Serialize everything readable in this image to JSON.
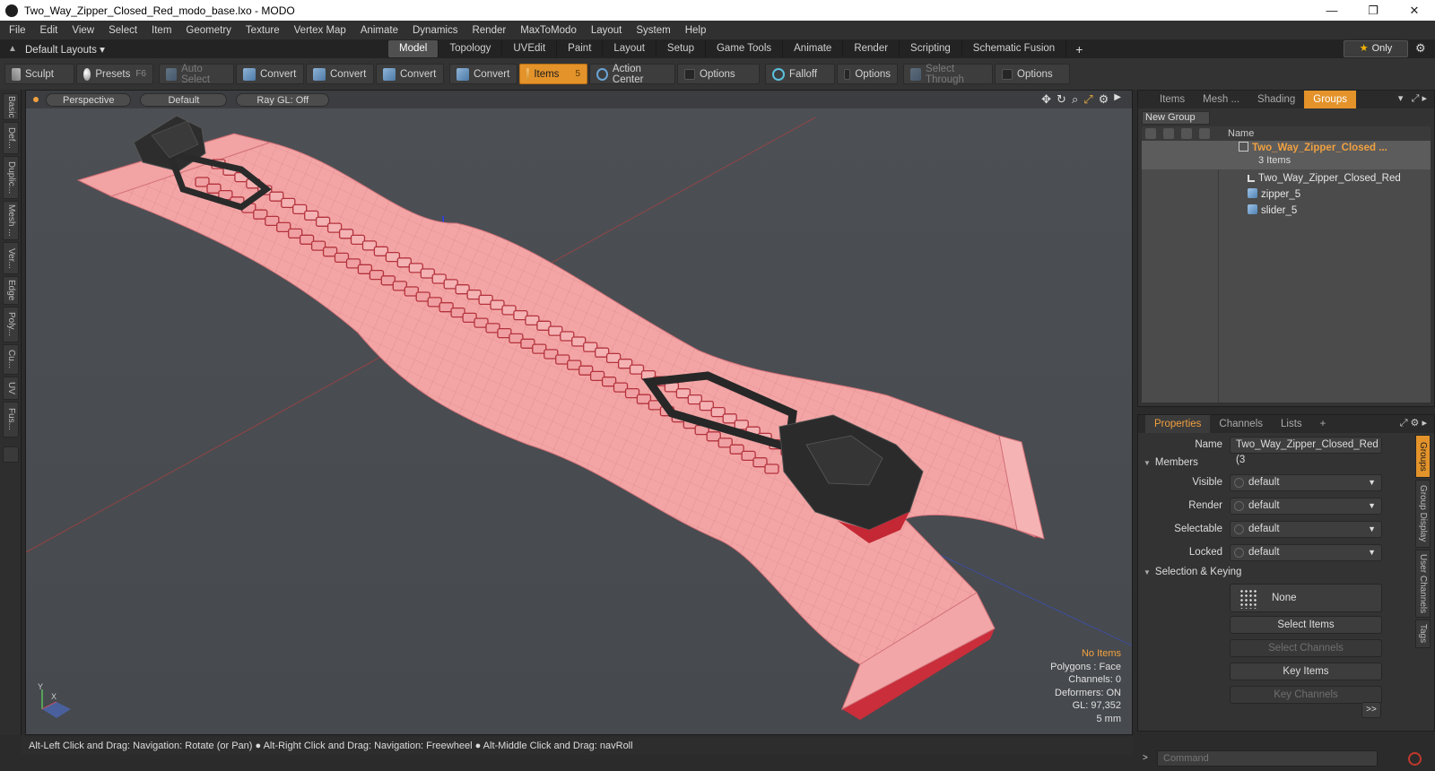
{
  "window": {
    "title": "Two_Way_Zipper_Closed_Red_modo_base.lxo - MODO",
    "controls": [
      "—",
      "❐",
      "✕"
    ]
  },
  "menu": [
    "File",
    "Edit",
    "View",
    "Select",
    "Item",
    "Geometry",
    "Texture",
    "Vertex Map",
    "Animate",
    "Dynamics",
    "Render",
    "MaxToModo",
    "Layout",
    "System",
    "Help"
  ],
  "layoutbar": {
    "layouts_label": "Default Layouts ▾",
    "tabs": [
      "Model",
      "Topology",
      "UVEdit",
      "Paint",
      "Layout",
      "Setup",
      "Game Tools",
      "Animate",
      "Render",
      "Scripting",
      "Schematic Fusion"
    ],
    "active_tab": "Model",
    "plus": "+",
    "only_label": "Only"
  },
  "toolbar": {
    "sculpt": "Sculpt",
    "presets": "Presets",
    "presets_key": "F6",
    "auto_select": "Auto Select",
    "convert": "Convert",
    "items": "Items",
    "items_key": "5",
    "action_center": "Action Center",
    "options": "Options",
    "falloff": "Falloff",
    "select_through": "Select Through"
  },
  "left_tabs": [
    "Basic",
    "Def...",
    "Duplic...",
    "Mesh ...",
    "Ver...",
    "Edge",
    "Poly...",
    "Cu...",
    "UV",
    "Fus..."
  ],
  "viewport": {
    "view_mode": "Perspective",
    "shading": "Default",
    "raygl": "Ray GL: Off",
    "info": {
      "no_items": "No Items",
      "polygons": "Polygons : Face",
      "channels": "Channels: 0",
      "deformers": "Deformers: ON",
      "gl": "GL: 97,352",
      "scale": "5 mm"
    },
    "axis": {
      "y": "Y",
      "x": "X"
    }
  },
  "status": "Alt-Left Click and Drag: Navigation: Rotate (or Pan) ● Alt-Right Click and Drag: Navigation: Freewheel ● Alt-Middle Click and Drag: navRoll",
  "groups_panel": {
    "tabs": [
      "Items",
      "Mesh ...",
      "Shading",
      "Groups"
    ],
    "active_tab": "Groups",
    "new_group": "New Group",
    "name_col": "Name",
    "group_name": "Two_Way_Zipper_Closed ...",
    "group_count": "3 Items",
    "children": [
      "Two_Way_Zipper_Closed_Red",
      "zipper_5",
      "slider_5"
    ]
  },
  "properties_panel": {
    "tabs": [
      "Properties",
      "Channels",
      "Lists"
    ],
    "active_tab": "Properties",
    "plus": "+",
    "name_label": "Name",
    "name_value": "Two_Way_Zipper_Closed_Red (3",
    "members_label": "Members",
    "rows": [
      {
        "label": "Visible",
        "value": "default"
      },
      {
        "label": "Render",
        "value": "default"
      },
      {
        "label": "Selectable",
        "value": "default"
      },
      {
        "label": "Locked",
        "value": "default"
      }
    ],
    "selection_keying": "Selection & Keying",
    "none_label": "None",
    "buttons": {
      "select_items": "Select Items",
      "select_channels": "Select Channels",
      "key_items": "Key Items",
      "key_channels": "Key Channels",
      "more": ">>"
    },
    "side_tabs": [
      "Groups",
      "Group Display",
      "User Channels",
      "Tags"
    ]
  },
  "command": {
    "placeholder": "Command",
    "prompt": ">"
  },
  "colors": {
    "accent": "#e3932a",
    "zipper_tape": "#f3a5a5",
    "slider": "#2a2a2a"
  }
}
